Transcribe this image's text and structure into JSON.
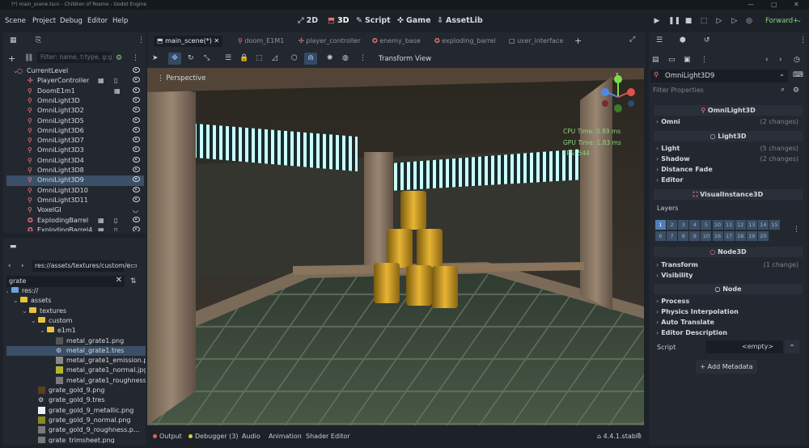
{
  "window": {
    "title": "(*) main_scene.tscn - Children of Rosmo - Godot Engine"
  },
  "menu": [
    "Scene",
    "Project",
    "Debug",
    "Editor",
    "Help"
  ],
  "modes": [
    {
      "label": "2D",
      "icon": "2d-icon"
    },
    {
      "label": "3D",
      "icon": "3d-icon"
    },
    {
      "label": "Script",
      "icon": "script-icon"
    },
    {
      "label": "Game",
      "icon": "game-icon"
    },
    {
      "label": "AssetLib",
      "icon": "assetlib-icon"
    }
  ],
  "renderer": "Forward+",
  "scene_panel": {
    "filter_placeholder": "Filter: name, t:type, g:group",
    "rows": [
      {
        "label": "CurrentLevel",
        "indent": 1,
        "icon": "node3d"
      },
      {
        "label": "PlayerController",
        "indent": 2,
        "icon": "player",
        "extra": true
      },
      {
        "label": "DoomE1m1",
        "indent": 2,
        "icon": "pin",
        "extra2": true
      },
      {
        "label": "OmniLight3D",
        "indent": 2,
        "icon": "pin"
      },
      {
        "label": "OmniLight3D2",
        "indent": 2,
        "icon": "pin"
      },
      {
        "label": "OmniLight3D5",
        "indent": 2,
        "icon": "pin"
      },
      {
        "label": "OmniLight3D6",
        "indent": 2,
        "icon": "pin"
      },
      {
        "label": "OmniLight3D7",
        "indent": 2,
        "icon": "pin"
      },
      {
        "label": "OmniLight3D3",
        "indent": 2,
        "icon": "pin"
      },
      {
        "label": "OmniLight3D4",
        "indent": 2,
        "icon": "pin"
      },
      {
        "label": "OmniLight3D8",
        "indent": 2,
        "icon": "pin"
      },
      {
        "label": "OmniLight3D9",
        "indent": 2,
        "icon": "pin",
        "selected": true
      },
      {
        "label": "OmniLight3D10",
        "indent": 2,
        "icon": "pin"
      },
      {
        "label": "OmniLight3D11",
        "indent": 2,
        "icon": "pin"
      },
      {
        "label": "VoxelGI",
        "indent": 2,
        "icon": "pin"
      },
      {
        "label": "ExplodingBarrel",
        "indent": 2,
        "icon": "barrel",
        "extra": true
      },
      {
        "label": "ExplodingBarrel4",
        "indent": 2,
        "icon": "barrel",
        "extra": true
      }
    ]
  },
  "filesystem": {
    "path": "res://assets/textures/custom/e",
    "search": "grate",
    "rows": [
      {
        "label": "res://",
        "indent": 0,
        "kind": "folder-blue"
      },
      {
        "label": "assets",
        "indent": 1,
        "kind": "folder"
      },
      {
        "label": "textures",
        "indent": 2,
        "kind": "folder"
      },
      {
        "label": "custom",
        "indent": 3,
        "kind": "folder"
      },
      {
        "label": "e1m1",
        "indent": 4,
        "kind": "folder"
      },
      {
        "label": "metal_grate1.png",
        "indent": 5,
        "kind": "thumb-dark"
      },
      {
        "label": "metal_grate1.tres",
        "indent": 5,
        "kind": "tres",
        "selected": true
      },
      {
        "label": "metal_grate1_emission.p...",
        "indent": 5,
        "kind": "thumb-grate"
      },
      {
        "label": "metal_grate1_normal.jpg",
        "indent": 5,
        "kind": "thumb-yellow"
      },
      {
        "label": "metal_grate1_roughness...",
        "indent": 5,
        "kind": "thumb-grey"
      },
      {
        "label": "grate_gold_9.png",
        "indent": 3,
        "kind": "thumb-brown"
      },
      {
        "label": "grate_gold_9.tres",
        "indent": 3,
        "kind": "tres"
      },
      {
        "label": "grate_gold_9_metallic.png",
        "indent": 3,
        "kind": "thumb-white"
      },
      {
        "label": "grate_gold_9_normal.png",
        "indent": 3,
        "kind": "thumb-olive"
      },
      {
        "label": "grate_gold_9_roughness.p...",
        "indent": 3,
        "kind": "thumb-grey"
      },
      {
        "label": "grate_trimsheet.png",
        "indent": 3,
        "kind": "thumb-grey"
      }
    ]
  },
  "tabs": [
    {
      "label": "main_scene(*)",
      "active": true
    },
    {
      "label": "doom_E1M1"
    },
    {
      "label": "player_controller"
    },
    {
      "label": "enemy_base"
    },
    {
      "label": "exploding_barrel"
    },
    {
      "label": "user_interface"
    }
  ],
  "viewport_toolbar": {
    "transform": "Transform",
    "view": "View"
  },
  "viewport": {
    "perspective": "Perspective",
    "cpu_time": "CPU Time: 0.89 ms",
    "gpu_time": "GPU Time: 1.83 ms",
    "fps": "FPS: 544",
    "gizmo_y": "Y"
  },
  "bottom_tabs": [
    {
      "label": "Output",
      "dot": "#e06060"
    },
    {
      "label": "Debugger (3)",
      "dot": "#d8d040"
    },
    {
      "label": "Audio"
    },
    {
      "label": "Animation"
    },
    {
      "label": "Shader Editor"
    }
  ],
  "version": "4.4.1.stable",
  "inspector": {
    "node_name": "OmniLight3D9",
    "filter_placeholder": "Filter Properties",
    "sections": [
      {
        "title": "OmniLight3D",
        "icon": "pin"
      },
      {
        "prop": "Omni",
        "changes": "(2 changes)"
      },
      {
        "title": "Light3D",
        "icon": "circle"
      },
      {
        "prop": "Light",
        "changes": "(5 changes)"
      },
      {
        "prop": "Shadow",
        "changes": "(2 changes)"
      },
      {
        "prop": "Distance Fade",
        "changes": ""
      },
      {
        "prop": "Editor",
        "changes": ""
      },
      {
        "title": "VisualInstance3D",
        "icon": "visual"
      },
      {
        "prop": "Transform",
        "changes": "(1 change)"
      },
      {
        "prop": "Visibility",
        "changes": ""
      },
      {
        "title": "Node3D",
        "icon": "node3d"
      },
      {
        "title": "Node",
        "icon": "circle-white"
      },
      {
        "prop": "Process",
        "changes": ""
      },
      {
        "prop": "Physics Interpolation",
        "changes": ""
      },
      {
        "prop": "Auto Translate",
        "changes": ""
      },
      {
        "prop": "Editor Description",
        "changes": ""
      }
    ],
    "layers_label": "Layers",
    "layers_row1": [
      "1",
      "2",
      "3",
      "4",
      "5",
      "10",
      "11",
      "12",
      "13",
      "14",
      "15"
    ],
    "layers_row2": [
      "6",
      "7",
      "8",
      "9",
      "10",
      "16",
      "17",
      "18",
      "19",
      "20"
    ],
    "script_label": "Script",
    "script_value": "<empty>",
    "add_metadata": "Add Metadata"
  },
  "colors": {
    "accent": "#478cbf",
    "node_red": "#fc7f7f",
    "selected": "#3b4f66"
  }
}
